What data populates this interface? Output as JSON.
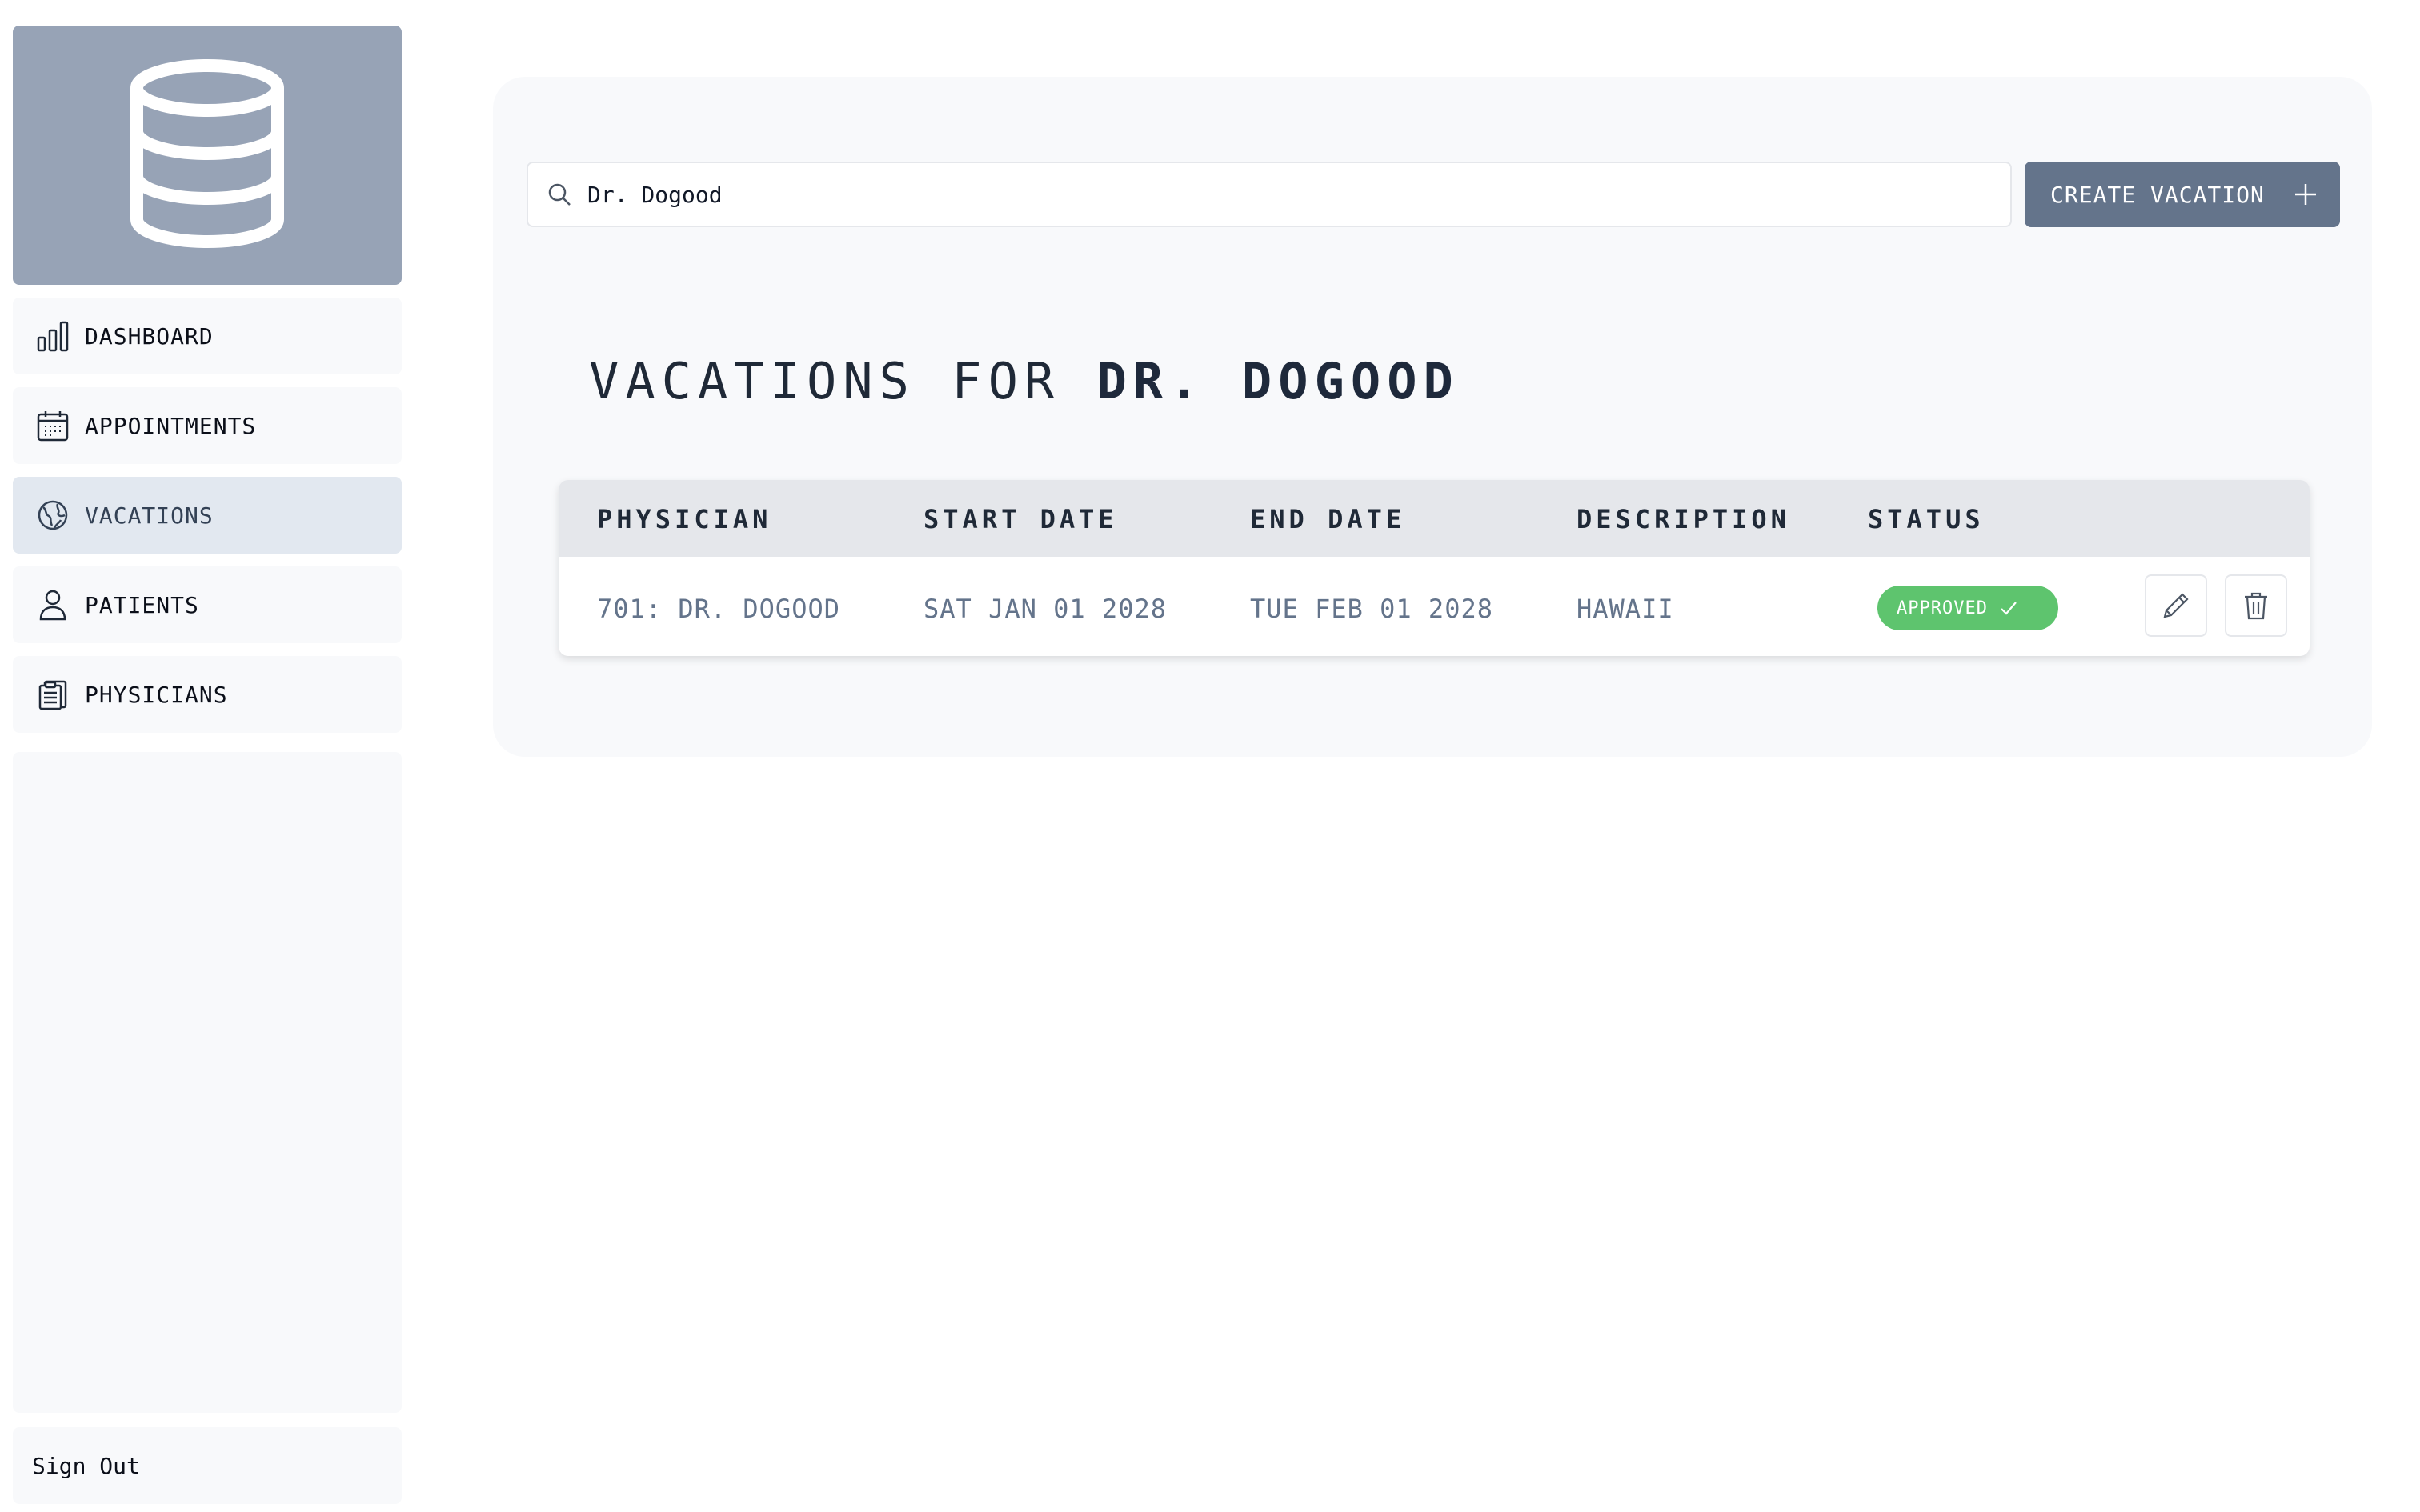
{
  "sidebar": {
    "logo_icon": "database-icon",
    "items": [
      {
        "label": "DASHBOARD",
        "icon": "bar-chart-icon",
        "active": false
      },
      {
        "label": "APPOINTMENTS",
        "icon": "calendar-icon",
        "active": false
      },
      {
        "label": "VACATIONS",
        "icon": "globe-icon",
        "active": true
      },
      {
        "label": "PATIENTS",
        "icon": "user-icon",
        "active": false
      },
      {
        "label": "PHYSICIANS",
        "icon": "clipboard-icon",
        "active": false
      }
    ],
    "signout_label": "Sign Out"
  },
  "search": {
    "value": "Dr. Dogood",
    "icon": "search-icon"
  },
  "create_button": {
    "label": "CREATE VACATION",
    "icon": "plus-icon"
  },
  "heading": {
    "prefix": "VACATIONS FOR ",
    "name": "DR. DOGOOD"
  },
  "table": {
    "columns": [
      "PHYSICIAN",
      "START DATE",
      "END DATE",
      "DESCRIPTION",
      "STATUS"
    ],
    "rows": [
      {
        "physician": "701: DR. DOGOOD",
        "start_date": "SAT JAN 01 2028",
        "end_date": "TUE FEB 01 2028",
        "description": "HAWAII",
        "status": "APPROVED",
        "status_icon": "check-icon",
        "actions": [
          "pencil-icon",
          "trash-icon"
        ]
      }
    ]
  },
  "colors": {
    "logo_bg": "#97a3b6",
    "primary_button": "#64748b",
    "status_approved": "#5ec46e",
    "active_nav": "#e2e8f0"
  }
}
